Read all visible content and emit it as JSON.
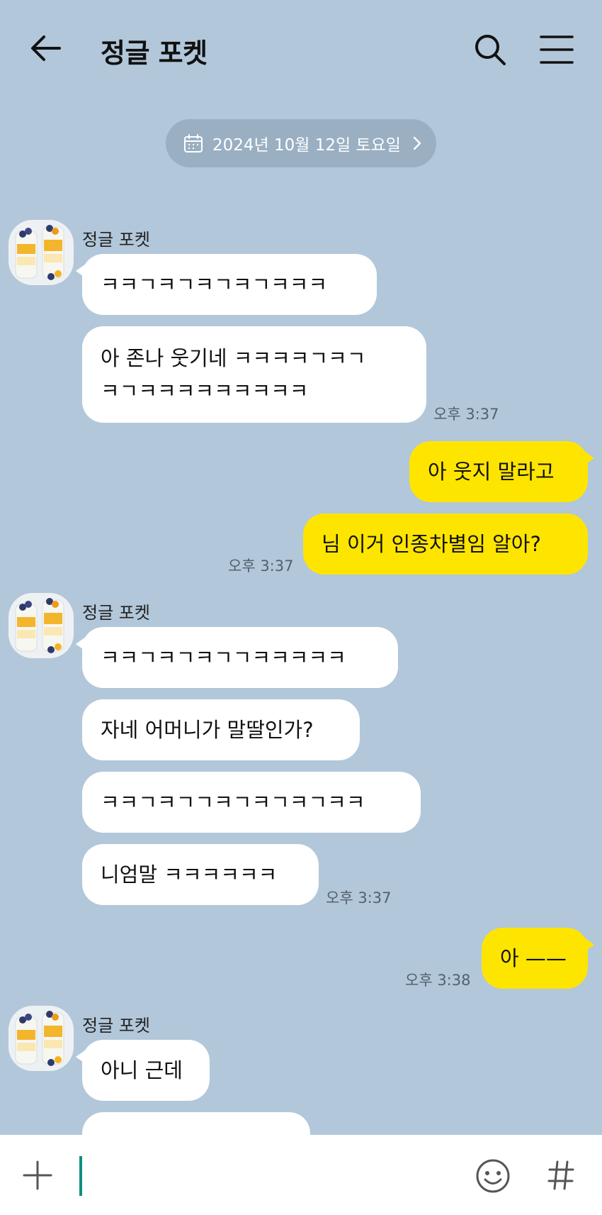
{
  "header": {
    "title": "정글 포켓",
    "back_icon": "arrow-left-icon",
    "search_icon": "search-icon",
    "menu_icon": "hamburger-menu-icon"
  },
  "date_divider": {
    "label": "2024년 10월 12일 토요일",
    "icon": "calendar-icon",
    "chevron": "chevron-right-icon"
  },
  "messages": [
    {
      "sender": "정글 포켓",
      "bubbles": [
        "ㅋㅋㄱㅋㄱㅋㄱㅋㄱㅋㅋㅋ",
        "아 존나 웃기네 ㅋㅋㅋㅋㄱㅋㄱ\nㅋㄱㅋㅋㅋㅋㅋㅋㅋㅋㅋ"
      ],
      "time": "오후 3:37"
    },
    {
      "sender": "me",
      "bubbles": [
        "아 웃지 말라고",
        "님 이거 인종차별임 알아?"
      ],
      "time": "오후 3:37"
    },
    {
      "sender": "정글 포켓",
      "bubbles": [
        "ㅋㅋㄱㅋㄱㅋㄱㄱㅋㅋㅋㅋㅋ",
        "자네 어머니가 말딸인가?",
        "ㅋㅋㄱㅋㄱㄱㅋㄱㅋㄱㅋㄱㅋㅋ",
        "니엄말 ㅋㅋㅋㅋㅋㅋ"
      ],
      "time": "오후 3:37"
    },
    {
      "sender": "me",
      "bubbles": [
        "아 ——"
      ],
      "time": "오후 3:38"
    },
    {
      "sender": "정글 포켓",
      "bubbles": [
        "아니 근데",
        ""
      ]
    }
  ],
  "input": {
    "placeholder": "",
    "value": "",
    "plus_icon": "plus-icon",
    "emoji_icon": "emoji-icon",
    "hash_icon": "hash-icon"
  },
  "colors": {
    "background": "#b2c7da",
    "my_bubble": "#fee500",
    "their_bubble": "#ffffff",
    "date_pill": "#9aafc2",
    "caret": "#0e8f7e"
  }
}
